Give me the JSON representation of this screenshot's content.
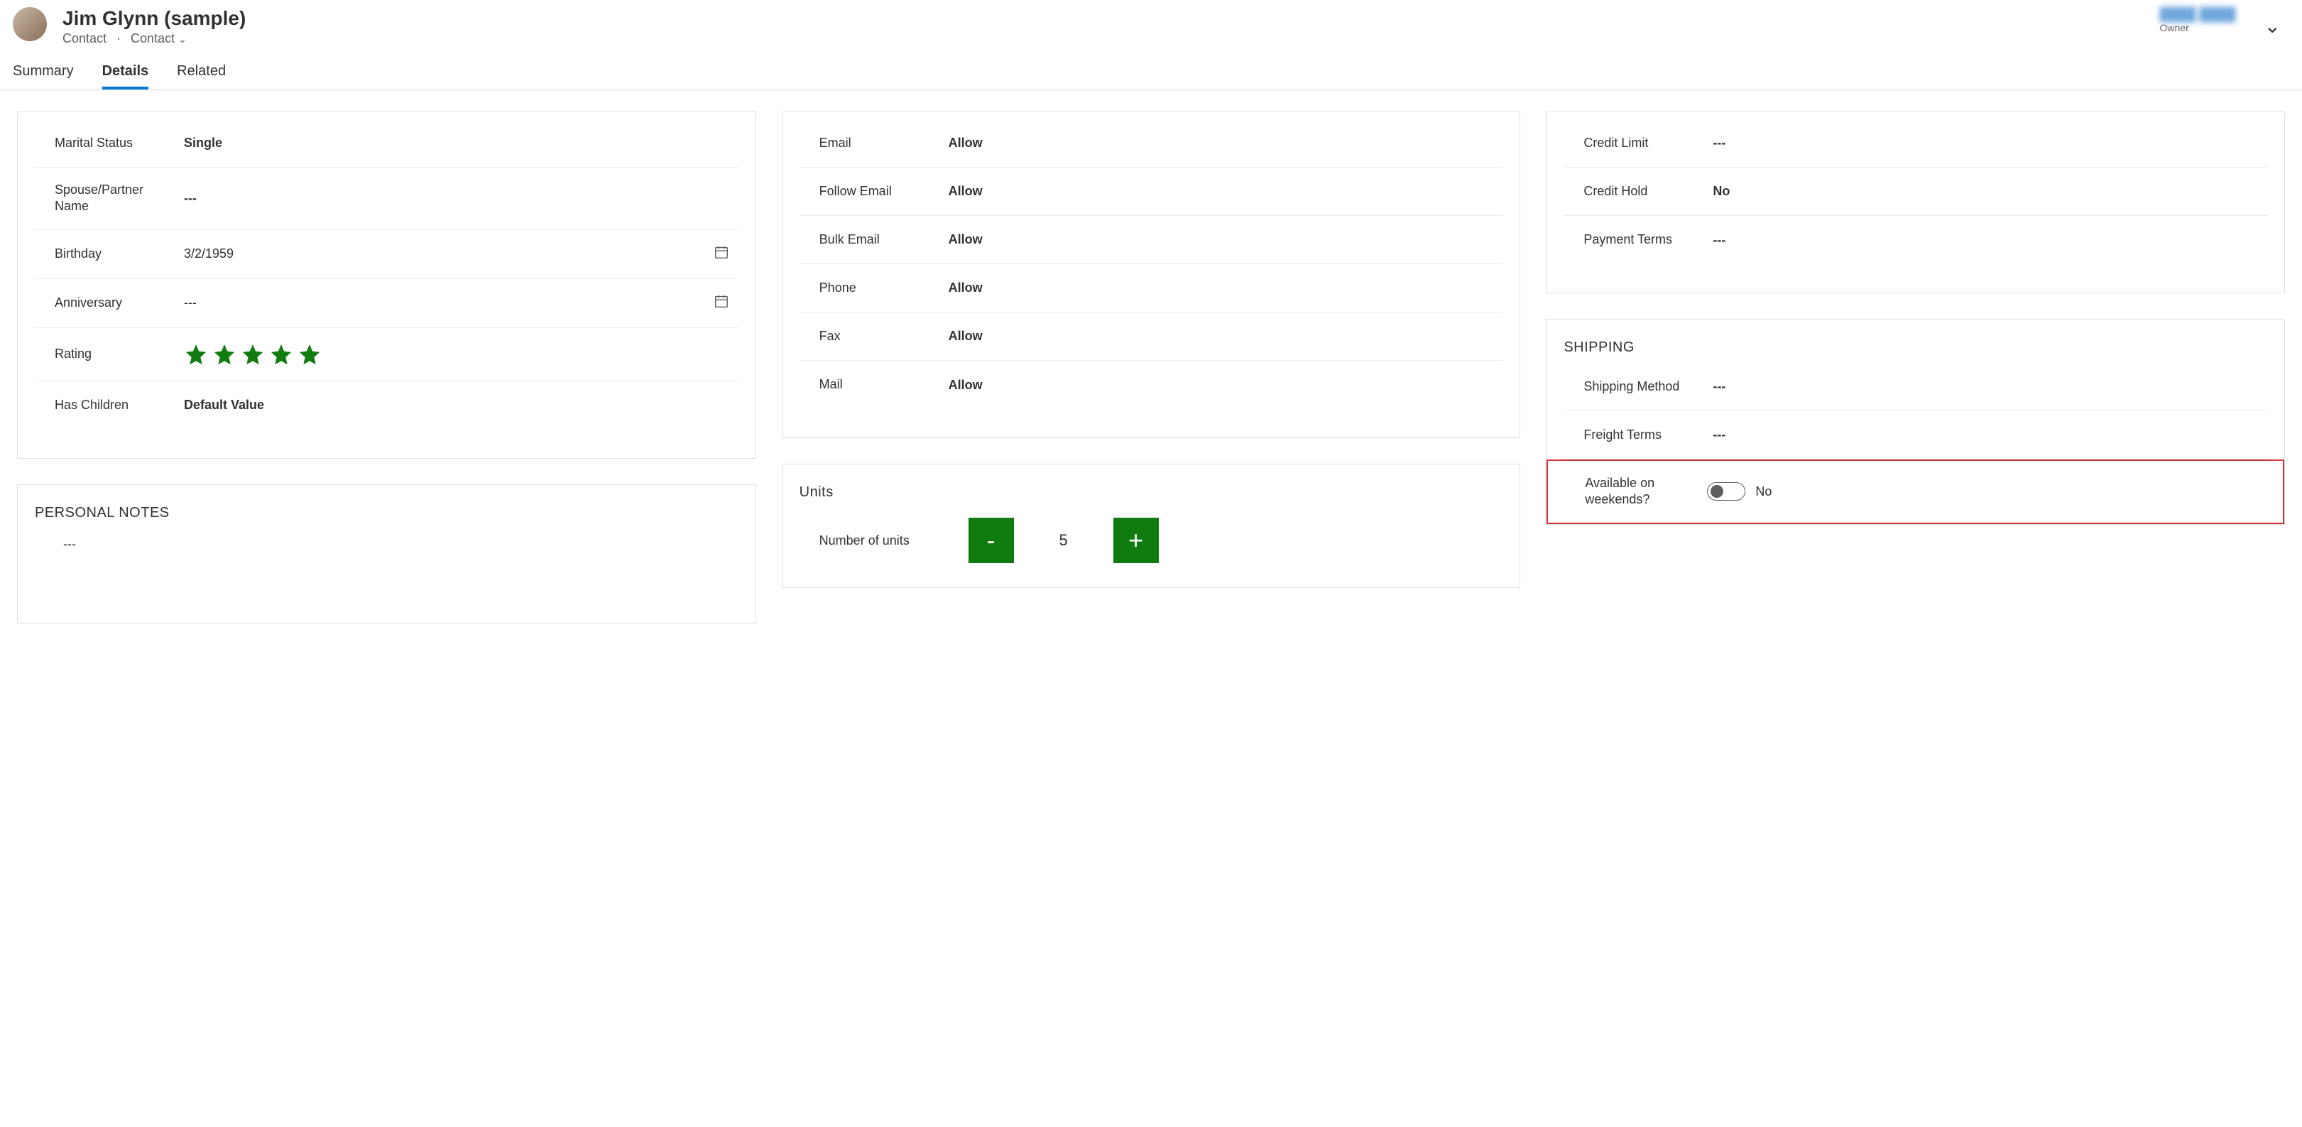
{
  "header": {
    "title": "Jim Glynn (sample)",
    "entity": "Contact",
    "form_selector": "Contact",
    "owner_label": "Owner"
  },
  "tabs": {
    "summary": "Summary",
    "details": "Details",
    "related": "Related",
    "active": "Details"
  },
  "personal": {
    "marital_status": {
      "label": "Marital Status",
      "value": "Single"
    },
    "spouse": {
      "label": "Spouse/Partner Name",
      "value": "---"
    },
    "birthday": {
      "label": "Birthday",
      "value": "3/2/1959"
    },
    "anniversary": {
      "label": "Anniversary",
      "value": "---"
    },
    "rating": {
      "label": "Rating",
      "stars": 5
    },
    "has_children": {
      "label": "Has Children",
      "value": "Default Value"
    }
  },
  "personal_notes": {
    "heading": "PERSONAL NOTES",
    "value": "---"
  },
  "contact_prefs": {
    "email": {
      "label": "Email",
      "value": "Allow"
    },
    "follow_email": {
      "label": "Follow Email",
      "value": "Allow"
    },
    "bulk_email": {
      "label": "Bulk Email",
      "value": "Allow"
    },
    "phone": {
      "label": "Phone",
      "value": "Allow"
    },
    "fax": {
      "label": "Fax",
      "value": "Allow"
    },
    "mail": {
      "label": "Mail",
      "value": "Allow"
    }
  },
  "units": {
    "heading": "Units",
    "label": "Number of units",
    "value": "5",
    "minus": "-",
    "plus": "+"
  },
  "billing": {
    "credit_limit": {
      "label": "Credit Limit",
      "value": "---"
    },
    "credit_hold": {
      "label": "Credit Hold",
      "value": "No"
    },
    "payment_terms": {
      "label": "Payment Terms",
      "value": "---"
    }
  },
  "shipping": {
    "heading": "SHIPPING",
    "method": {
      "label": "Shipping Method",
      "value": "---"
    },
    "freight": {
      "label": "Freight Terms",
      "value": "---"
    },
    "weekends": {
      "label": "Available on weekends?",
      "value": "No"
    }
  }
}
